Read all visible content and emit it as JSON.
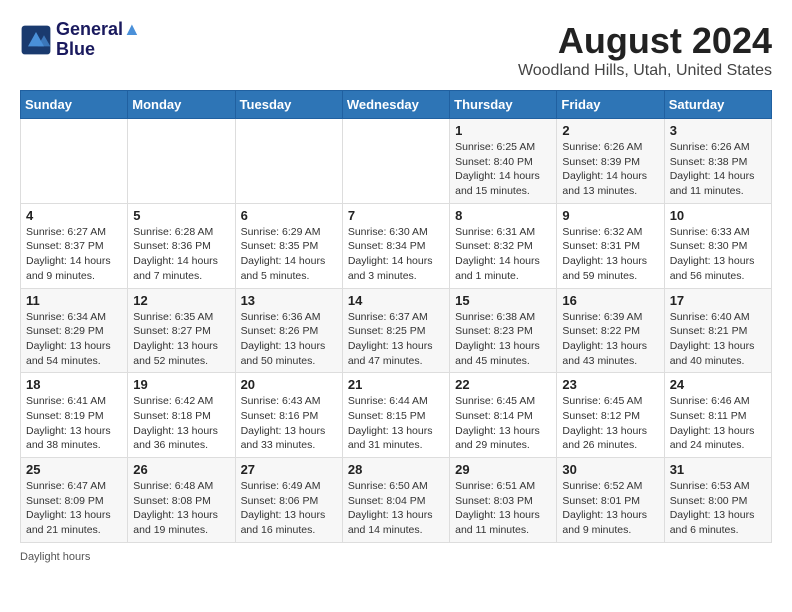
{
  "logo": {
    "line1": "General",
    "line2": "Blue"
  },
  "title": "August 2024",
  "subtitle": "Woodland Hills, Utah, United States",
  "days_of_week": [
    "Sunday",
    "Monday",
    "Tuesday",
    "Wednesday",
    "Thursday",
    "Friday",
    "Saturday"
  ],
  "footer": "Daylight hours",
  "weeks": [
    [
      {
        "day": "",
        "info": ""
      },
      {
        "day": "",
        "info": ""
      },
      {
        "day": "",
        "info": ""
      },
      {
        "day": "",
        "info": ""
      },
      {
        "day": "1",
        "info": "Sunrise: 6:25 AM\nSunset: 8:40 PM\nDaylight: 14 hours and 15 minutes."
      },
      {
        "day": "2",
        "info": "Sunrise: 6:26 AM\nSunset: 8:39 PM\nDaylight: 14 hours and 13 minutes."
      },
      {
        "day": "3",
        "info": "Sunrise: 6:26 AM\nSunset: 8:38 PM\nDaylight: 14 hours and 11 minutes."
      }
    ],
    [
      {
        "day": "4",
        "info": "Sunrise: 6:27 AM\nSunset: 8:37 PM\nDaylight: 14 hours and 9 minutes."
      },
      {
        "day": "5",
        "info": "Sunrise: 6:28 AM\nSunset: 8:36 PM\nDaylight: 14 hours and 7 minutes."
      },
      {
        "day": "6",
        "info": "Sunrise: 6:29 AM\nSunset: 8:35 PM\nDaylight: 14 hours and 5 minutes."
      },
      {
        "day": "7",
        "info": "Sunrise: 6:30 AM\nSunset: 8:34 PM\nDaylight: 14 hours and 3 minutes."
      },
      {
        "day": "8",
        "info": "Sunrise: 6:31 AM\nSunset: 8:32 PM\nDaylight: 14 hours and 1 minute."
      },
      {
        "day": "9",
        "info": "Sunrise: 6:32 AM\nSunset: 8:31 PM\nDaylight: 13 hours and 59 minutes."
      },
      {
        "day": "10",
        "info": "Sunrise: 6:33 AM\nSunset: 8:30 PM\nDaylight: 13 hours and 56 minutes."
      }
    ],
    [
      {
        "day": "11",
        "info": "Sunrise: 6:34 AM\nSunset: 8:29 PM\nDaylight: 13 hours and 54 minutes."
      },
      {
        "day": "12",
        "info": "Sunrise: 6:35 AM\nSunset: 8:27 PM\nDaylight: 13 hours and 52 minutes."
      },
      {
        "day": "13",
        "info": "Sunrise: 6:36 AM\nSunset: 8:26 PM\nDaylight: 13 hours and 50 minutes."
      },
      {
        "day": "14",
        "info": "Sunrise: 6:37 AM\nSunset: 8:25 PM\nDaylight: 13 hours and 47 minutes."
      },
      {
        "day": "15",
        "info": "Sunrise: 6:38 AM\nSunset: 8:23 PM\nDaylight: 13 hours and 45 minutes."
      },
      {
        "day": "16",
        "info": "Sunrise: 6:39 AM\nSunset: 8:22 PM\nDaylight: 13 hours and 43 minutes."
      },
      {
        "day": "17",
        "info": "Sunrise: 6:40 AM\nSunset: 8:21 PM\nDaylight: 13 hours and 40 minutes."
      }
    ],
    [
      {
        "day": "18",
        "info": "Sunrise: 6:41 AM\nSunset: 8:19 PM\nDaylight: 13 hours and 38 minutes."
      },
      {
        "day": "19",
        "info": "Sunrise: 6:42 AM\nSunset: 8:18 PM\nDaylight: 13 hours and 36 minutes."
      },
      {
        "day": "20",
        "info": "Sunrise: 6:43 AM\nSunset: 8:16 PM\nDaylight: 13 hours and 33 minutes."
      },
      {
        "day": "21",
        "info": "Sunrise: 6:44 AM\nSunset: 8:15 PM\nDaylight: 13 hours and 31 minutes."
      },
      {
        "day": "22",
        "info": "Sunrise: 6:45 AM\nSunset: 8:14 PM\nDaylight: 13 hours and 29 minutes."
      },
      {
        "day": "23",
        "info": "Sunrise: 6:45 AM\nSunset: 8:12 PM\nDaylight: 13 hours and 26 minutes."
      },
      {
        "day": "24",
        "info": "Sunrise: 6:46 AM\nSunset: 8:11 PM\nDaylight: 13 hours and 24 minutes."
      }
    ],
    [
      {
        "day": "25",
        "info": "Sunrise: 6:47 AM\nSunset: 8:09 PM\nDaylight: 13 hours and 21 minutes."
      },
      {
        "day": "26",
        "info": "Sunrise: 6:48 AM\nSunset: 8:08 PM\nDaylight: 13 hours and 19 minutes."
      },
      {
        "day": "27",
        "info": "Sunrise: 6:49 AM\nSunset: 8:06 PM\nDaylight: 13 hours and 16 minutes."
      },
      {
        "day": "28",
        "info": "Sunrise: 6:50 AM\nSunset: 8:04 PM\nDaylight: 13 hours and 14 minutes."
      },
      {
        "day": "29",
        "info": "Sunrise: 6:51 AM\nSunset: 8:03 PM\nDaylight: 13 hours and 11 minutes."
      },
      {
        "day": "30",
        "info": "Sunrise: 6:52 AM\nSunset: 8:01 PM\nDaylight: 13 hours and 9 minutes."
      },
      {
        "day": "31",
        "info": "Sunrise: 6:53 AM\nSunset: 8:00 PM\nDaylight: 13 hours and 6 minutes."
      }
    ]
  ]
}
